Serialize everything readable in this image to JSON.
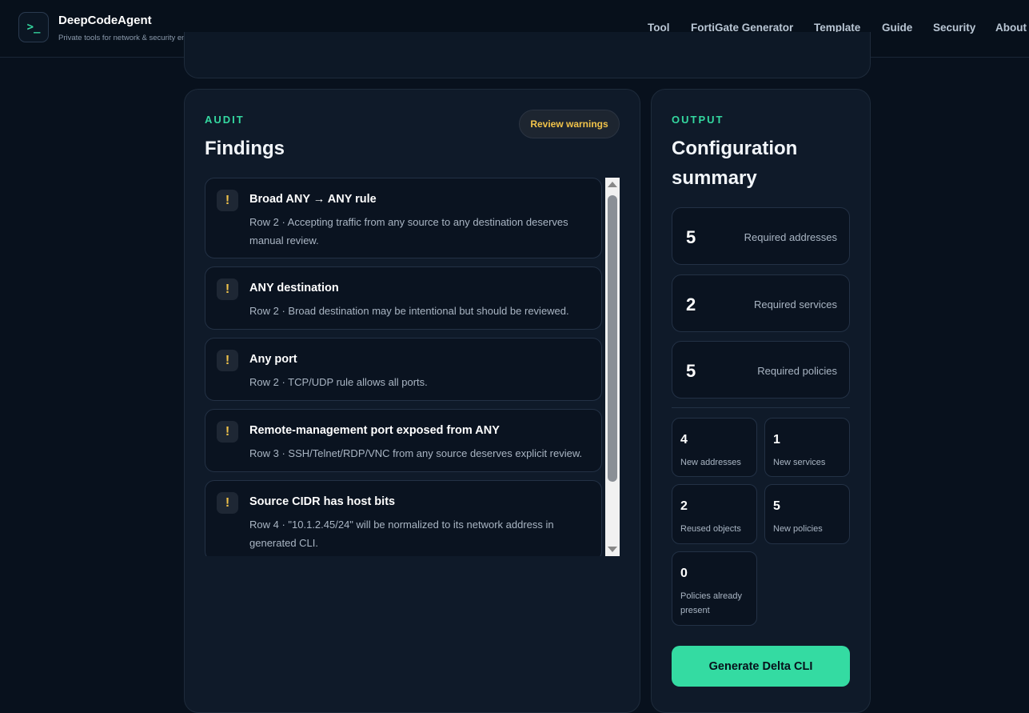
{
  "header": {
    "logo_glyph": ">_",
    "brand_name": "DeepCodeAgent",
    "brand_tagline": "Private tools for network & security engineers",
    "nav": [
      "Tool",
      "FortiGate Generator",
      "Template",
      "Guide",
      "Security",
      "About"
    ]
  },
  "audit": {
    "eyebrow": "AUDIT",
    "title": "Findings",
    "status_pill": "Review warnings",
    "findings": [
      {
        "icon": "!",
        "title": "Broad ANY → ANY rule",
        "description": "Row 2 · Accepting traffic from any source to any destination deserves manual review."
      },
      {
        "icon": "!",
        "title": "ANY destination",
        "description": "Row 2 · Broad destination may be intentional but should be reviewed."
      },
      {
        "icon": "!",
        "title": "Any port",
        "description": "Row 2 · TCP/UDP rule allows all ports."
      },
      {
        "icon": "!",
        "title": "Remote-management port exposed from ANY",
        "description": "Row 3 · SSH/Telnet/RDP/VNC from any source deserves explicit review."
      },
      {
        "icon": "!",
        "title": "Source CIDR has host bits",
        "description": "Row 4 · \"10.1.2.45/24\" will be normalized to its network address in generated CLI."
      }
    ]
  },
  "output": {
    "eyebrow": "OUTPUT",
    "title": "Configuration summary",
    "required": [
      {
        "value": "5",
        "label": "Required addresses"
      },
      {
        "value": "2",
        "label": "Required services"
      },
      {
        "value": "5",
        "label": "Required policies"
      }
    ],
    "details": [
      {
        "value": "4",
        "label": "New addresses"
      },
      {
        "value": "1",
        "label": "New services"
      },
      {
        "value": "2",
        "label": "Reused objects"
      },
      {
        "value": "5",
        "label": "New policies"
      },
      {
        "value": "0",
        "label": "Policies already present"
      }
    ],
    "generate_button": "Generate Delta CLI"
  },
  "colors": {
    "accent": "#34d8a0",
    "warning": "#f1c34a",
    "background": "#08111d",
    "panel": "#0f1a29"
  }
}
